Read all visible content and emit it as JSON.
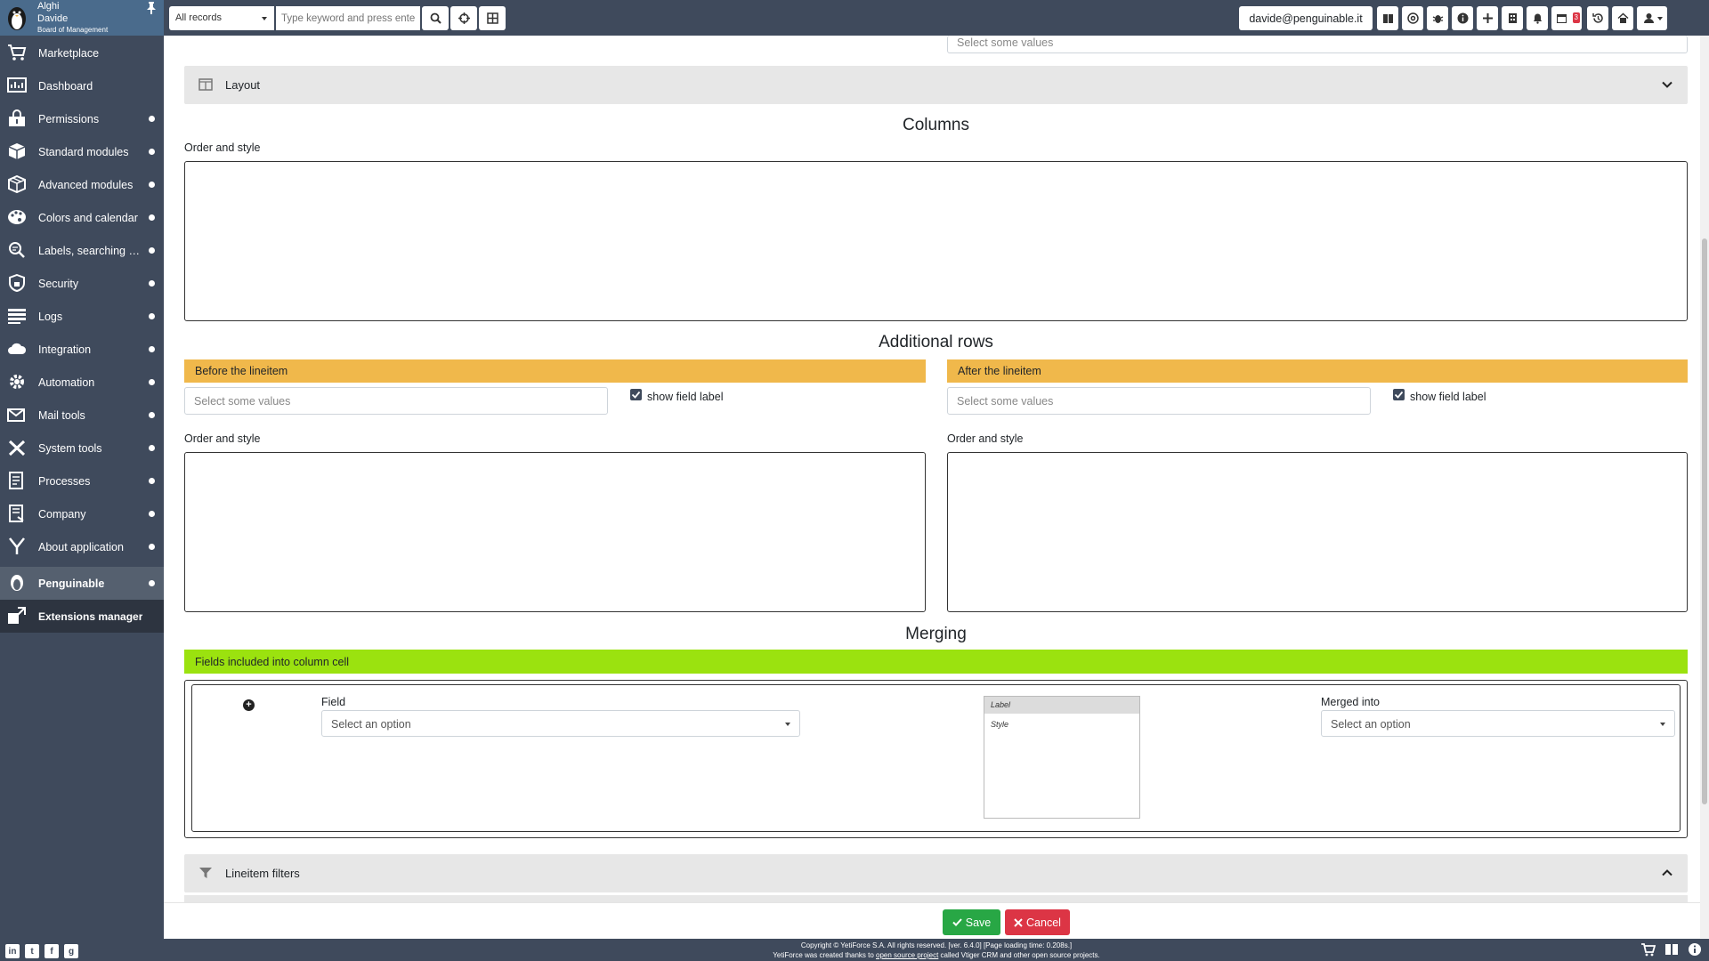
{
  "user": {
    "name_line1": "Alghi",
    "name_line2": "Davide",
    "role": "Board of Management"
  },
  "sidebar": {
    "items": [
      {
        "label": "Marketplace",
        "icon": "cart-icon"
      },
      {
        "label": "Dashboard",
        "icon": "dashboard-icon"
      },
      {
        "label": "Permissions",
        "icon": "lock-icon"
      },
      {
        "label": "Standard modules",
        "icon": "cube-icon"
      },
      {
        "label": "Advanced modules",
        "icon": "cubes-icon"
      },
      {
        "label": "Colors and calendar",
        "icon": "palette-icon"
      },
      {
        "label": "Labels, searching and filtering",
        "icon": "search-list-icon"
      },
      {
        "label": "Security",
        "icon": "shield-icon"
      },
      {
        "label": "Logs",
        "icon": "list-icon"
      },
      {
        "label": "Integration",
        "icon": "cloud-icon"
      },
      {
        "label": "Automation",
        "icon": "gears-icon"
      },
      {
        "label": "Mail tools",
        "icon": "mail-icon"
      },
      {
        "label": "System tools",
        "icon": "tools-icon"
      },
      {
        "label": "Processes",
        "icon": "processes-icon"
      },
      {
        "label": "Company",
        "icon": "company-icon"
      },
      {
        "label": "About application",
        "icon": "yeti-icon"
      },
      {
        "label": "Penguinable",
        "icon": "penguin-icon"
      },
      {
        "label": "Extensions manager",
        "icon": "extensions-icon"
      }
    ]
  },
  "header": {
    "records_select": "All records",
    "search_placeholder": "Type keyword and press enter",
    "email": "davide@penguinable.it",
    "calendar_badge": "3"
  },
  "main": {
    "top_select_placeholder": "Select some values",
    "layout_panel": "Layout",
    "columns_title": "Columns",
    "order_style": "Order and style",
    "additional_rows_title": "Additional rows",
    "before_lineitem": "Before the lineitem",
    "after_lineitem": "After the lineitem",
    "select_values_placeholder": "Select some values",
    "show_field_label": "show field label",
    "merging_title": "Merging",
    "fields_included": "Fields included into column cell",
    "field_label": "Field",
    "select_option": "Select an option",
    "preview_label": "Label",
    "preview_style": "Style",
    "merged_into": "Merged into",
    "lineitem_filters": "Lineitem filters"
  },
  "actions": {
    "save": "Save",
    "cancel": "Cancel"
  },
  "footer": {
    "line1": "Copyright © YetiForce S.A. All rights reserved. [ver. 6.4.0] [Page loading time: 0.208s.]",
    "line2_pre": "YetiForce was created thanks to ",
    "line2_link": "open source project",
    "line2_post": " called Vtiger CRM and other open source projects."
  },
  "colors": {
    "sidebar_bg": "#3f4a5c",
    "user_panel_bg": "#4a6b8c",
    "yellow_bar": "#f0b84b",
    "green_bar": "#9be20f",
    "save_green": "#28a745",
    "cancel_red": "#dc3545"
  }
}
